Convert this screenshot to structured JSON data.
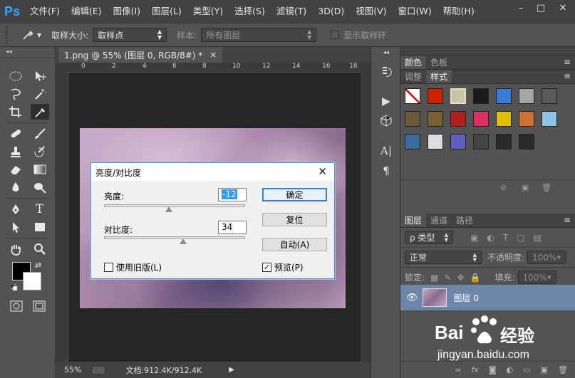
{
  "app": {
    "logo": "Ps"
  },
  "menubar": {
    "items": [
      "文件(F)",
      "编辑(E)",
      "图像(I)",
      "图层(L)",
      "类型(Y)",
      "选择(S)",
      "滤镜(T)",
      "3D(D)",
      "视图(V)",
      "窗口(W)",
      "帮助(H)"
    ]
  },
  "window_controls": {
    "minimize": "–",
    "maximize": "□",
    "close": "✕"
  },
  "options": {
    "sample_size_label": "取样大小:",
    "sample_size_value": "取样点",
    "sample_label": "样本:",
    "sample_value": "所有图层",
    "show_ring_label": "显示取样环"
  },
  "document": {
    "tab_title": "1.png @ 55% (图层 0, RGB/8#) *",
    "tab_close": "×",
    "ruler_ticks": [
      "0",
      "2",
      "4",
      "6",
      "8",
      "10",
      "12",
      "14",
      "16",
      "18"
    ],
    "zoom": "55%",
    "doc_info": "文档:912.4K/912.4K"
  },
  "dialog": {
    "title": "亮度/对比度",
    "close": "✕",
    "brightness_label": "亮度:",
    "brightness_value": "-12",
    "brightness_slider": -12,
    "contrast_label": "对比度:",
    "contrast_value": "34",
    "contrast_slider": 34,
    "ok": "确定",
    "reset": "复位",
    "auto": "自动(A)",
    "legacy_label": "使用旧版(L)",
    "legacy_checked": false,
    "preview_label": "预览(P)",
    "preview_checked": true
  },
  "panels": {
    "swatch_tabs": [
      "颜色",
      "色板"
    ],
    "style_tabs": [
      "调整",
      "样式"
    ],
    "layer_tabs": [
      "图层",
      "通道",
      "路径"
    ],
    "layer_filter_value": "ρ 类型",
    "blend_mode": "正常",
    "opacity_label": "不透明度:",
    "opacity_value": "100%",
    "lock_label": "锁定:",
    "fill_label": "填充:",
    "fill_value": "100%",
    "layer_name": "图层 0",
    "footer_fx": "fx"
  },
  "watermark": {
    "brand_a": "Bai",
    "brand_b": "经验",
    "url": "jingyan.baidu.com"
  },
  "colors": {
    "accent_blue": "#31a8ff",
    "selected_layer": "#6e87a8",
    "dialog_border": "#5b8bc6",
    "foreground": "#000000",
    "background": "#ffffff"
  },
  "style_swatches": [
    "#ffffff",
    "#cc2200",
    "#c9c2a8",
    "#1a1a1a",
    "#3a7bd5",
    "#a6a6a6",
    "#5a5a5a",
    "#6b5a3a",
    "#7a6030",
    "#b02020",
    "#e03060",
    "#e0c000",
    "#d07030",
    "#8ec4e6",
    "#3a6aa0",
    "#dddddd",
    "#6060c0",
    "#444444",
    "#2a2a2a",
    "#2a2a2a"
  ]
}
